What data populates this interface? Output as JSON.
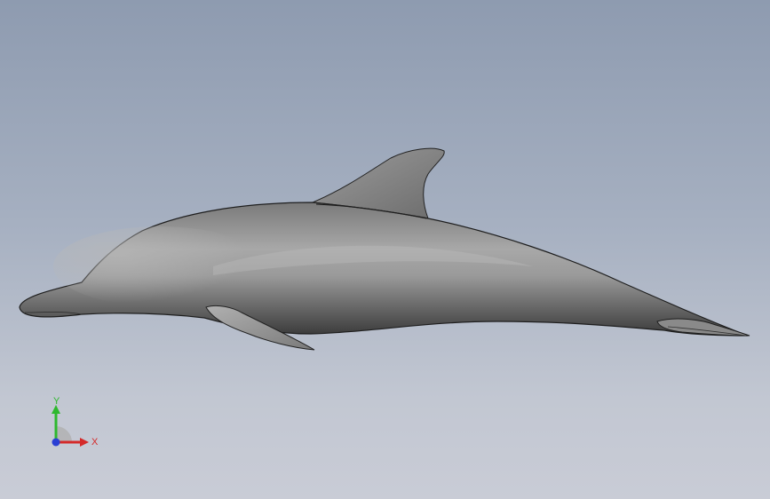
{
  "viewport": {
    "model": "dolphin-3d-model",
    "background_top": "#8e9bb0",
    "background_bottom": "#c9ccd6"
  },
  "triad": {
    "x_label": "X",
    "y_label": "Y",
    "x_color": "#d42a2a",
    "y_color": "#2eb82e",
    "z_color": "#2a3fd4"
  }
}
